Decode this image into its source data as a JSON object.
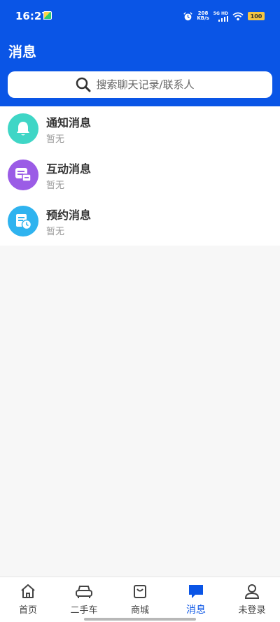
{
  "status_bar": {
    "time": "16:27",
    "speed_value": "208",
    "speed_unit": "KB/s",
    "network": "5G HD",
    "battery": "100"
  },
  "header": {
    "title": "消息",
    "bg_color": "#0a55e6"
  },
  "search": {
    "placeholder": "搜索聊天记录/联系人"
  },
  "messages": [
    {
      "title": "通知消息",
      "subtitle": "暂无",
      "icon": "bell-icon"
    },
    {
      "title": "互动消息",
      "subtitle": "暂无",
      "icon": "chat-icon"
    },
    {
      "title": "预约消息",
      "subtitle": "暂无",
      "icon": "schedule-icon"
    }
  ],
  "tabs": [
    {
      "label": "首页",
      "icon": "home-icon"
    },
    {
      "label": "二手车",
      "icon": "car-icon"
    },
    {
      "label": "商城",
      "icon": "shop-bag-icon"
    },
    {
      "label": "消息",
      "icon": "message-icon",
      "active": true
    },
    {
      "label": "未登录",
      "icon": "user-icon"
    }
  ],
  "colors": {
    "accent": "#0a55e6",
    "notify": "#3fd6c6",
    "interact": "#9b5ce6",
    "appointment": "#2fb3ef"
  }
}
